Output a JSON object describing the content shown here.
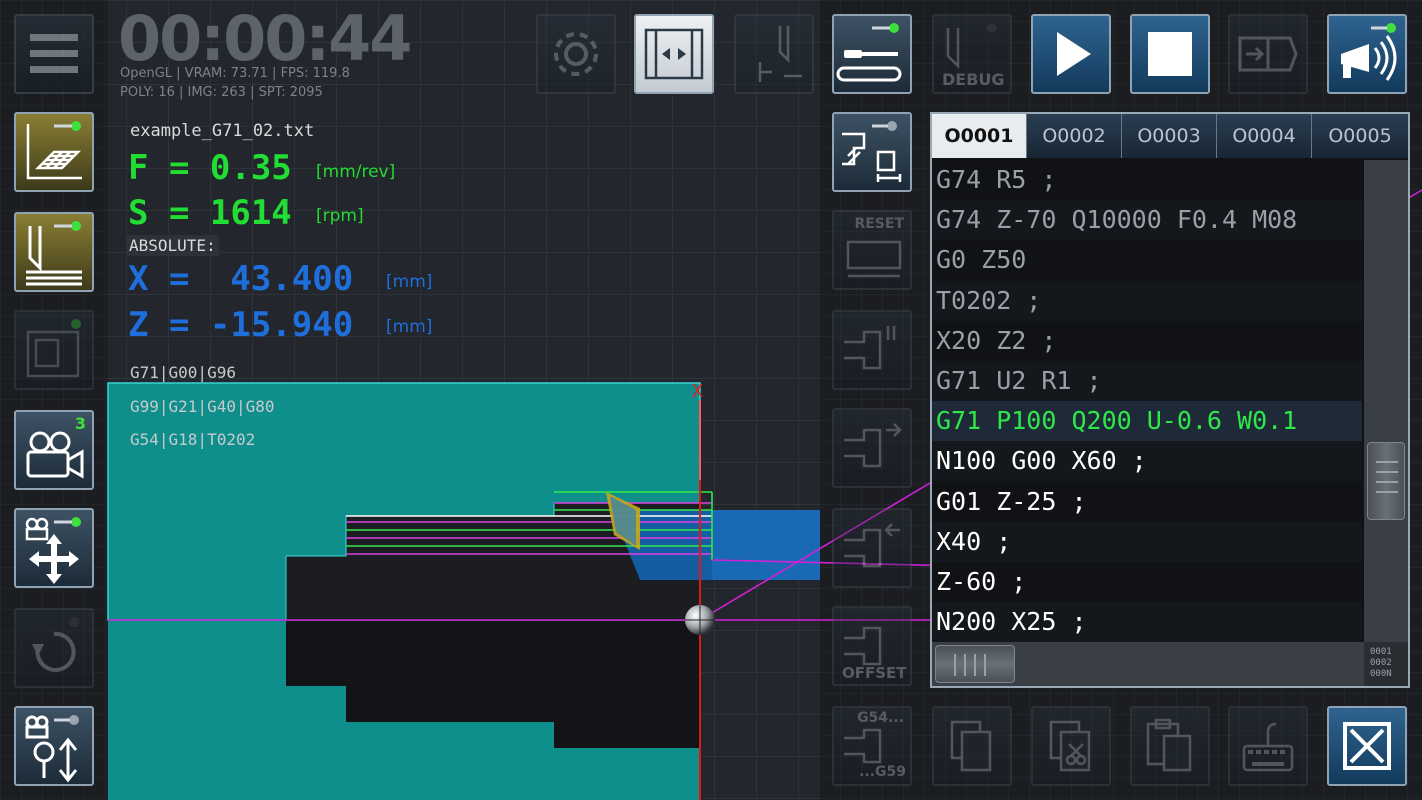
{
  "hud": {
    "timer": "00:00:44",
    "stats_line1": "OpenGL | VRAM: 73.71 | FPS: 119.8",
    "stats_line2": "POLY: 16 | IMG: 263 | SPT: 2095",
    "filename": "example_G71_02.txt",
    "feed_label": "F = 0.35",
    "feed_unit": "[mm/rev]",
    "speed_label": "S = 1614",
    "speed_unit": "[rpm]",
    "mode": "ABSOLUTE:",
    "x_label": "X =  43.400",
    "x_unit": "[mm]",
    "z_label": "Z = -15.940",
    "z_unit": "[mm]",
    "gcodes_line1": "G71|G00|G96",
    "gcodes_line2": "G99|G21|G40|G80",
    "gcodes_line3": "G54|G18|T0202",
    "axis_x_marker": "X"
  },
  "left_toolbar": {
    "camera_badge": "3"
  },
  "top_toolbar": {
    "debug_label": "DEBUG"
  },
  "mid_toolbar": {
    "reset_label": "RESET",
    "offset_label": "OFFSET",
    "g54_label": "G54...",
    "g59_label": "...G59"
  },
  "code_panel": {
    "tabs": [
      "O0001",
      "O0002",
      "O0003",
      "O0004",
      "O0005"
    ],
    "active_tab": 0,
    "lines": [
      {
        "text": "G74 R5 ;",
        "state": "past"
      },
      {
        "text": "G74 Z-70 Q10000 F0.4 M08",
        "state": "past"
      },
      {
        "text": "G0 Z50",
        "state": "past"
      },
      {
        "text": "T0202 ;",
        "state": "past"
      },
      {
        "text": "X20 Z2 ;",
        "state": "past"
      },
      {
        "text": "G71 U2 R1 ;",
        "state": "past"
      },
      {
        "text": "G71 P100 Q200 U-0.6 W0.1",
        "state": "current"
      },
      {
        "text": "N100 G00 X60 ;",
        "state": "future"
      },
      {
        "text": "G01 Z-25 ;",
        "state": "future"
      },
      {
        "text": "X40 ;",
        "state": "future"
      },
      {
        "text": "Z-60 ;",
        "state": "future"
      },
      {
        "text": "N200 X25 ;",
        "state": "future"
      }
    ],
    "corner_lines": [
      "0001",
      "0002",
      "000N"
    ]
  },
  "colors": {
    "stock": "#0f8f8c",
    "code_current": "#2ee84a",
    "feed_green": "#22dd33",
    "coord_blue": "#1e6fdc",
    "toolpath_magenta": "#d020d8"
  }
}
